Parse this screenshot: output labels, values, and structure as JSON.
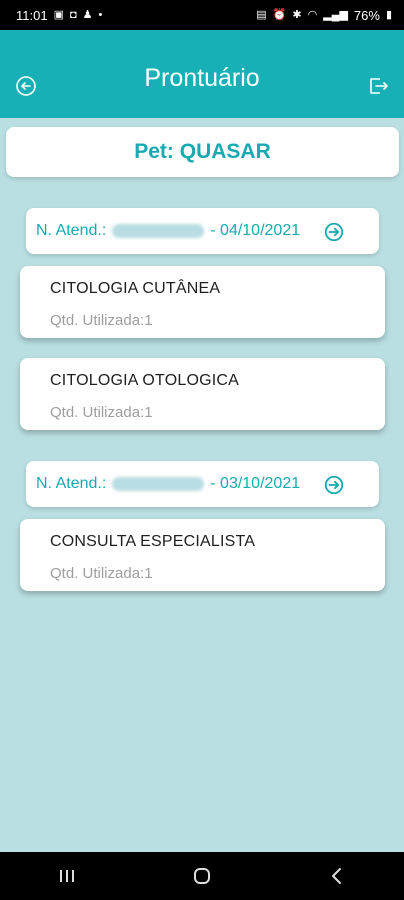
{
  "status": {
    "time": "11:01",
    "battery": "76%"
  },
  "header": {
    "title": "Prontuário"
  },
  "pet": {
    "label": "Pet: QUASAR"
  },
  "atendimentos": [
    {
      "prefix": "N. Atend.:",
      "date": "- 04/10/2021",
      "procedures": [
        {
          "name": "CITOLOGIA CUTÂNEA",
          "qtd": "Qtd. Utilizada:1"
        },
        {
          "name": "CITOLOGIA OTOLOGICA",
          "qtd": "Qtd. Utilizada:1"
        }
      ]
    },
    {
      "prefix": "N. Atend.:",
      "date": "- 03/10/2021",
      "procedures": [
        {
          "name": "CONSULTA ESPECIALISTA",
          "qtd": "Qtd. Utilizada:1"
        }
      ]
    }
  ],
  "colors": {
    "accent": "#17b0b6",
    "background": "#b9dfe2",
    "text_accent": "#17aab1"
  }
}
